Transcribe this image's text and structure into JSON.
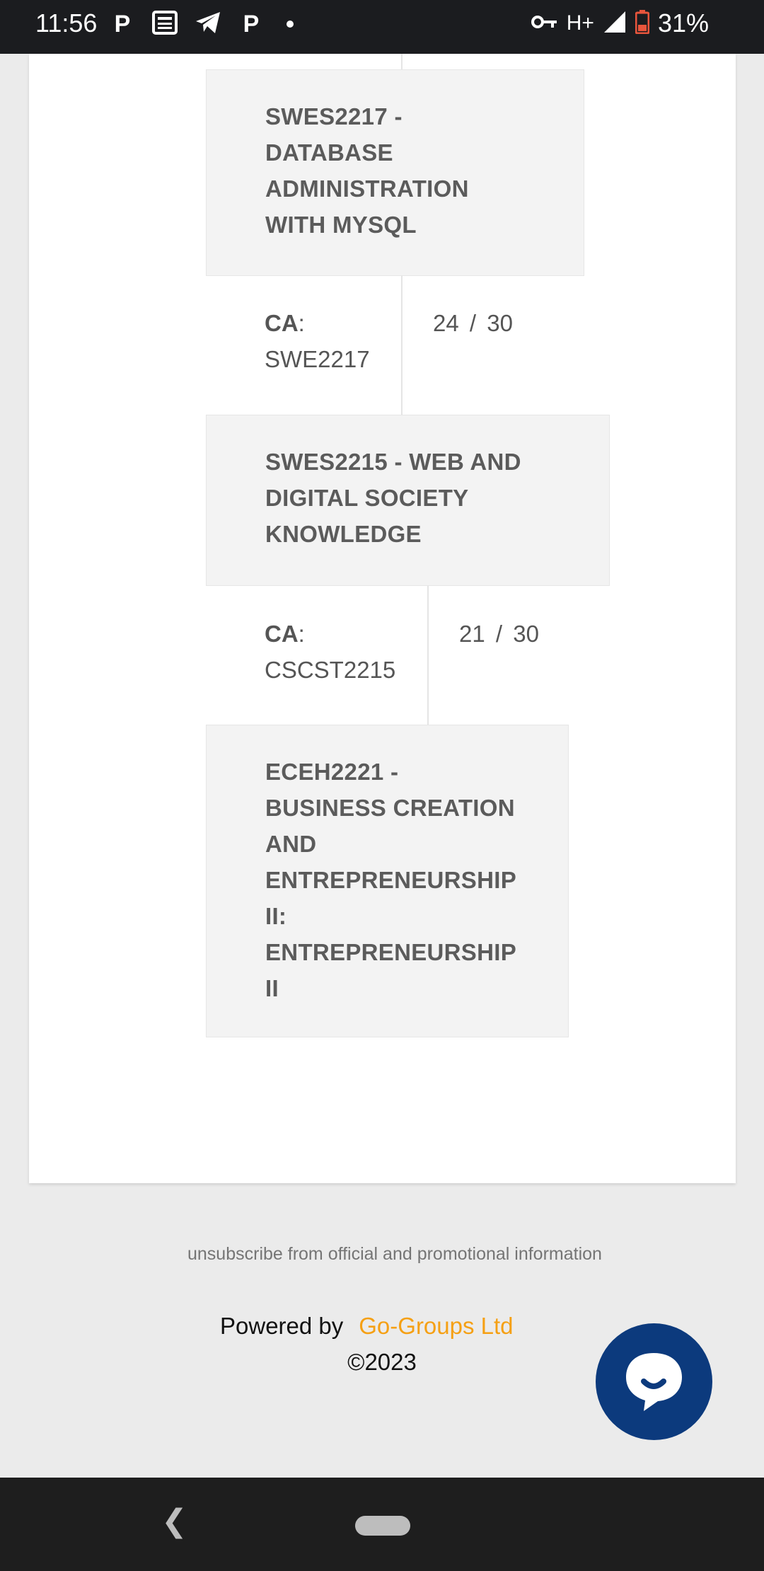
{
  "status_bar": {
    "time": "11:56",
    "left_icons": [
      "p-app-icon",
      "news-icon",
      "telegram-icon",
      "p-app-icon",
      "dot"
    ],
    "network": "H+",
    "battery": "31%"
  },
  "courses": [
    {
      "title": "SWES2217 - DATABASE ADMINISTRATION WITH MYSQL",
      "title_lines": [
        "SWES2217 -",
        "DATABASE",
        "ADMINISTRATION",
        "WITH MYSQL"
      ],
      "ca_label": "CA",
      "ca_code": "SWE2217",
      "score": "24",
      "max": "30"
    },
    {
      "title": "SWES2215 - WEB AND DIGITAL SOCIETY KNOWLEDGE",
      "title_lines": [
        "SWES2215 - WEB AND",
        "DIGITAL SOCIETY",
        "KNOWLEDGE"
      ],
      "ca_label": "CA",
      "ca_code": "CSCST2215",
      "score": "21",
      "max": "30"
    },
    {
      "title": "ECEH2221 - BUSINESS CREATION AND ENTREPRENEURSHIP II: ENTREPRENEURSHIP II",
      "title_lines": [
        "ECEH2221 -",
        "BUSINESS CREATION",
        "AND",
        "ENTREPRENEURSHIP",
        "II:",
        "ENTREPRENEURSHIP",
        "II"
      ]
    }
  ],
  "footer": {
    "unsubscribe": "unsubscribe from official and promotional information",
    "powered_by": "Powered by",
    "brand": "Go-Groups Ltd",
    "copyright": "©2023"
  },
  "colors": {
    "brand": "#f5a014",
    "chat_fab": "#0c3a7d",
    "header_bg": "#f3f3f3"
  }
}
